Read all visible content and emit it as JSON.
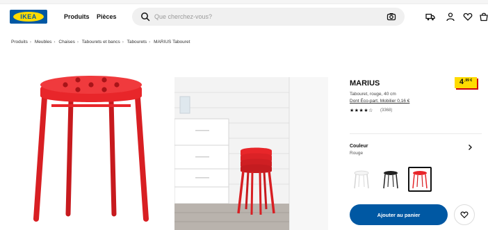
{
  "header": {
    "logo_text": "IKEA",
    "nav": {
      "produits": "Produits",
      "pieces": "Pièces"
    },
    "search_placeholder": "Que cherchez-vous?",
    "icons": [
      "search-icon",
      "camera-icon",
      "truck-icon",
      "user-icon",
      "heart-icon",
      "bag-icon"
    ]
  },
  "breadcrumb": [
    "Produits",
    "Meubles",
    "Chaises",
    "Tabourets et bancs",
    "Tabourets",
    "MARIUS Tabouret"
  ],
  "product": {
    "name": "MARIUS",
    "price_int": "4",
    "price_dec": ",99 €",
    "description": "Tabouret, rouge, 40 cm",
    "eco_text": "Dont Éco-part. Mobilier 0,16 €",
    "rating_stars": "★★★★☆",
    "rating_count": "(3368)",
    "color_label": "Couleur",
    "color_value": "Rouge",
    "swatches": [
      "white",
      "black",
      "red"
    ],
    "selected_swatch": "red",
    "add_to_cart": "Ajouter au panier"
  },
  "colors": {
    "brand_blue": "#0058a3",
    "brand_yellow": "#ffdb00",
    "stool_red": "#e8262a",
    "price_shadow": "#cc0008"
  }
}
